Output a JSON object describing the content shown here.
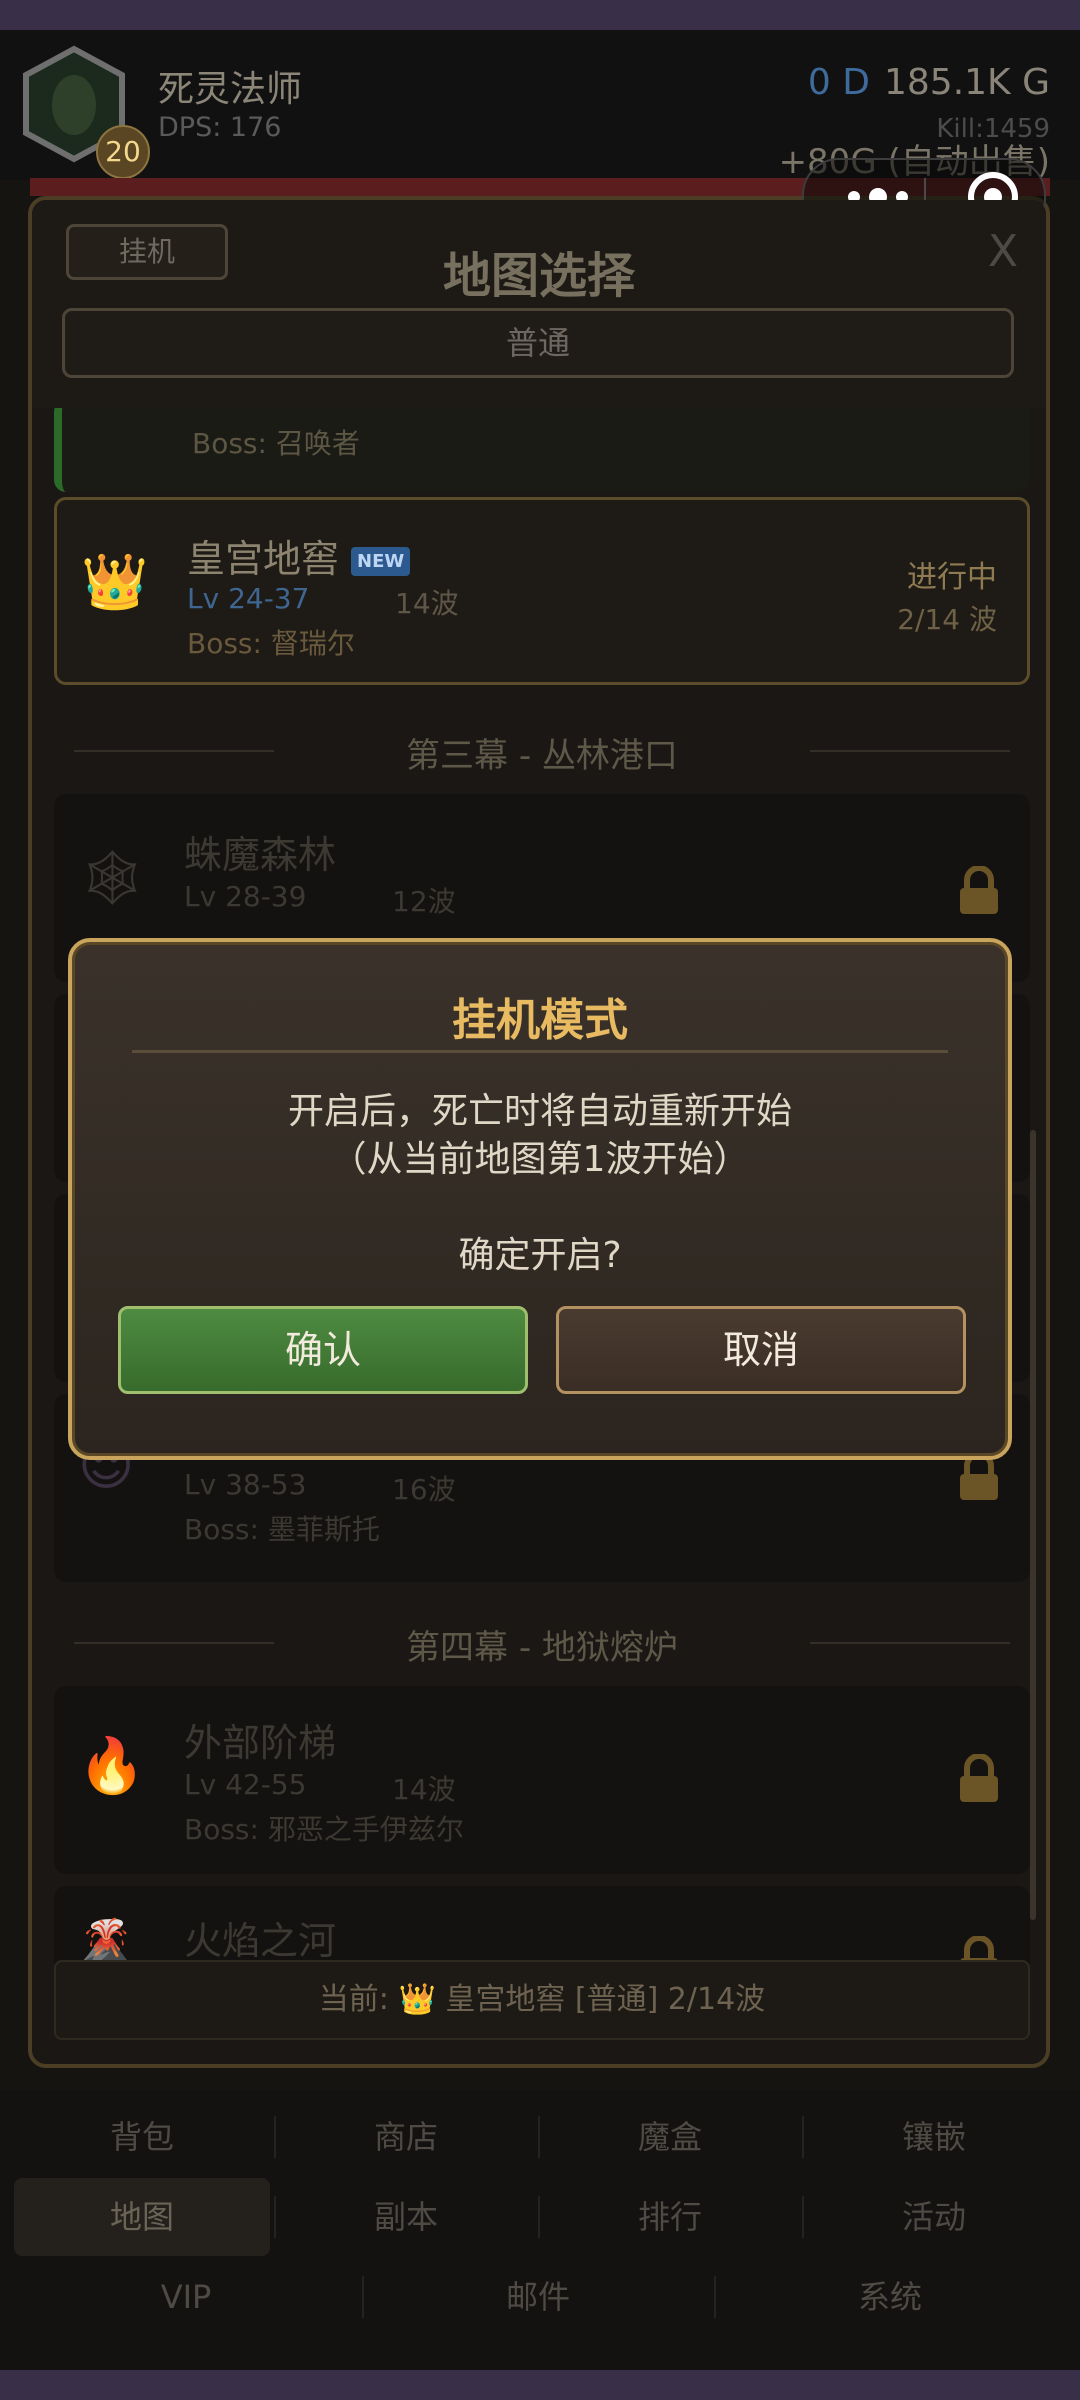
{
  "hud": {
    "player_name": "死灵法师",
    "level": "20",
    "dps": "DPS: 176",
    "diamonds": "0 D",
    "gold": "185.1K G",
    "kill": "Kill:1459",
    "gold_income": "+80G (自动出售)"
  },
  "panel": {
    "afk_button": "挂机",
    "title": "地图选择",
    "close": "X",
    "difficulty": "普通",
    "prev_card": {
      "boss": "Boss: 召唤者"
    },
    "current_card": {
      "icon": "crown-icon",
      "name": "皇宫地窖",
      "badge": "NEW",
      "level": "Lv 24-37",
      "waves": "14波",
      "boss": "Boss: 督瑞尔",
      "status": "进行中",
      "progress": "2/14 波"
    },
    "act3_header": "第三幕 - 丛林港口",
    "spider_card": {
      "icon": "spider-web-icon",
      "name": "蛛魔森林",
      "level": "Lv 28-39",
      "waves": "12波"
    },
    "demon_card": {
      "icon": "demon-face-icon",
      "level": "Lv 38-53",
      "waves": "16波",
      "boss": "Boss: 墨菲斯托"
    },
    "act4_header": "第四幕 - 地狱熔炉",
    "stairs_card": {
      "icon": "fire-icon",
      "name": "外部阶梯",
      "level": "Lv 42-55",
      "waves": "14波",
      "boss": "Boss: 邪恶之手伊兹尔"
    },
    "river_card": {
      "icon": "flame-river-icon",
      "name": "火焰之河"
    },
    "current_bar": "当前: 👑 皇宫地窖 [普通] 2/14波"
  },
  "dialog": {
    "title": "挂机模式",
    "line1": "开启后，死亡时将自动重新开始",
    "line2": "（从当前地图第1波开始）",
    "confirm_question": "确定开启?",
    "ok": "确认",
    "cancel": "取消"
  },
  "menu": {
    "row1": [
      "背包",
      "商店",
      "魔盒",
      "镶嵌"
    ],
    "row2": [
      "地图",
      "副本",
      "排行",
      "活动"
    ],
    "row3": [
      "VIP",
      "邮件",
      "系统"
    ],
    "active": "地图"
  },
  "colors": {
    "accent_gold": "#e8bb62",
    "confirm_green": "#4e8b41",
    "cancel_brown": "#4a3b30",
    "diamond_blue": "#3e6b9b"
  }
}
